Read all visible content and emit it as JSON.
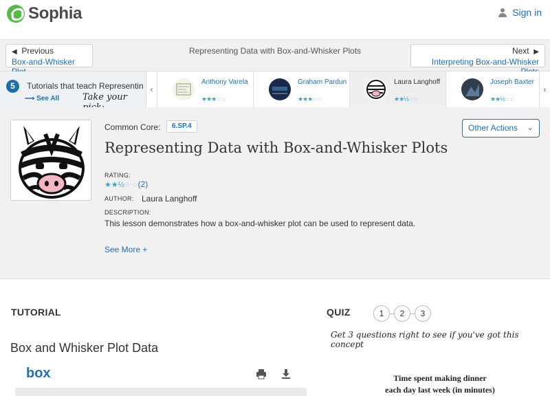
{
  "brand": {
    "name": "Sophia"
  },
  "header": {
    "signin_label": "Sign in"
  },
  "nav": {
    "prev_dir": "Previous",
    "prev_title": "Box-and-Whisker Plot",
    "center_title": "Representing Data with Box-and-Whisker Plots",
    "next_dir": "Next",
    "next_title": "Interpreting Box-and-Whisker Plots"
  },
  "tutorials_bar": {
    "count": "5",
    "label": "Tutorials that teach Representing Data with Box-and-Whisker Plots",
    "see_all": "See All",
    "take_pick": "Take your pick:",
    "prev_arrow": "‹",
    "next_arrow": "›",
    "cards": [
      {
        "name": "Anthony Varela",
        "stars": "★★★☆☆",
        "rating": 3
      },
      {
        "name": "Graham Pardun",
        "stars": "★★★☆☆",
        "rating": 3
      },
      {
        "name": "Laura Langhoff",
        "stars": "★★½☆☆",
        "rating": 2.5
      },
      {
        "name": "Joseph Baxter",
        "stars": "★★½☆☆",
        "rating": 2.5
      }
    ]
  },
  "lesson": {
    "common_core_label": "Common Core:",
    "common_core_code": "6.SP.4",
    "title": "Representing Data with Box-and-Whisker Plots",
    "other_actions": "Other Actions",
    "rating_label": "RATING:",
    "rating_count": "(2)",
    "rating_value": 2.5,
    "author_label": "AUTHOR:",
    "author": "Laura Langhoff",
    "description_label": "DESCRIPTION:",
    "description": "This lesson demonstrates how a box-and-whisker plot can be used to represent data.",
    "see_more": "See More +"
  },
  "tutorial_section": {
    "heading": "TUTORIAL",
    "content_title": "Box and Whisker Plot Data",
    "box_logo": "box"
  },
  "quiz_section": {
    "heading": "QUIZ",
    "steps": [
      "1",
      "2",
      "3"
    ],
    "note": "Get 3 questions right to see if you've got this concept",
    "question_title_line1": "Time spent making dinner",
    "question_title_line2": "each day last week (in minutes)"
  },
  "colors": {
    "brand_green": "#58b947",
    "link_blue": "#1f6fb5",
    "star_blue": "#3b9fd6"
  }
}
